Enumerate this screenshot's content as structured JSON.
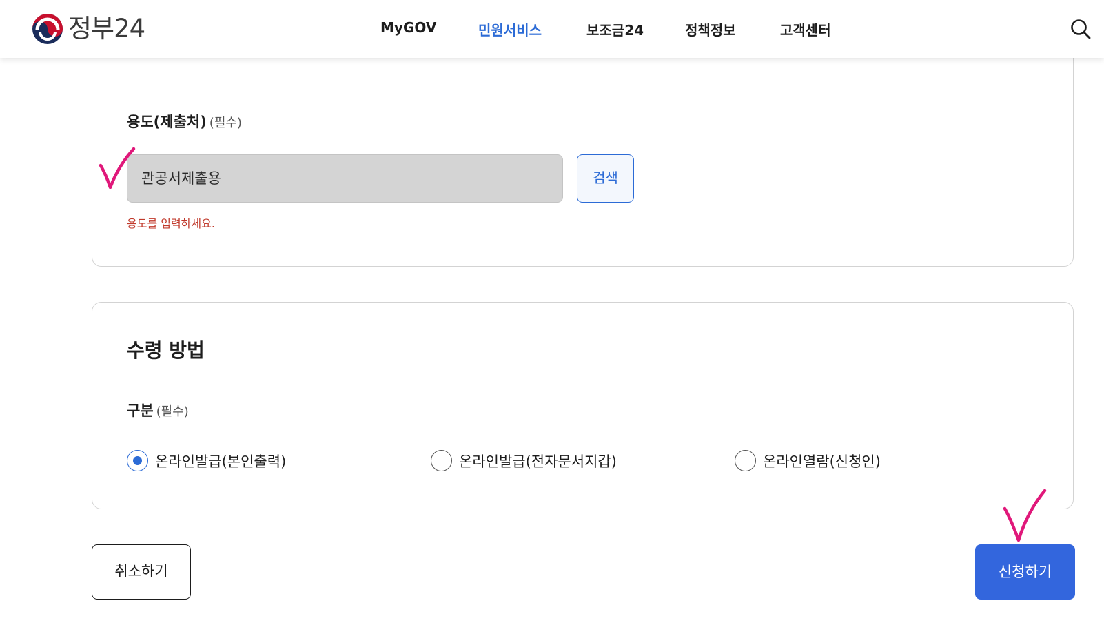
{
  "header": {
    "logo_text": "정부24",
    "nav": [
      {
        "label": "MyGOV",
        "active": false
      },
      {
        "label": "민원서비스",
        "active": true
      },
      {
        "label": "보조금24",
        "active": false
      },
      {
        "label": "정책정보",
        "active": false
      },
      {
        "label": "고객센터",
        "active": false
      }
    ],
    "search_icon": "search-icon"
  },
  "purpose": {
    "label": "용도(제출처)",
    "required": "(필수)",
    "value": "관공서제출용",
    "search_button": "검색",
    "error": "용도를 입력하세요."
  },
  "receipt": {
    "title": "수령 방법",
    "label": "구분",
    "required": "(필수)",
    "options": [
      {
        "label": "온라인발급(본인출력)",
        "checked": true
      },
      {
        "label": "온라인발급(전자문서지갑)",
        "checked": false
      },
      {
        "label": "온라인열람(신청인)",
        "checked": false
      }
    ]
  },
  "actions": {
    "cancel": "취소하기",
    "submit": "신청하기"
  },
  "colors": {
    "accent": "#2c6bd6",
    "submit_bg": "#3366dd",
    "error": "#c0392b",
    "annotation": "#e0187a"
  }
}
